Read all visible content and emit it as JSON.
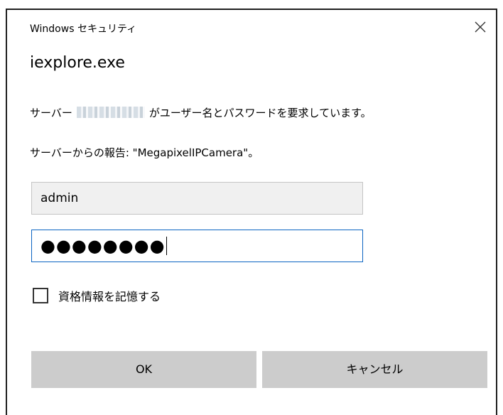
{
  "window": {
    "caption": "Windows セキュリティ",
    "app_title": "iexplore.exe"
  },
  "message": {
    "line1_before": "サーバー",
    "line1_after": "がユーザー名とパスワードを要求しています。",
    "line2": "サーバーからの報告: \"MegapixelIPCamera\"。"
  },
  "form": {
    "username_value": "admin",
    "password_masked": "●●●●●●●●",
    "remember_label": "資格情報を記憶する",
    "remember_checked": false
  },
  "buttons": {
    "ok_label": "OK",
    "cancel_label": "キャンセル"
  },
  "icons": {
    "close": "close-icon"
  },
  "colors": {
    "focus_border": "#0a64c2",
    "button_bg": "#cccccc",
    "disabled_field_bg": "#f0f0f0"
  }
}
